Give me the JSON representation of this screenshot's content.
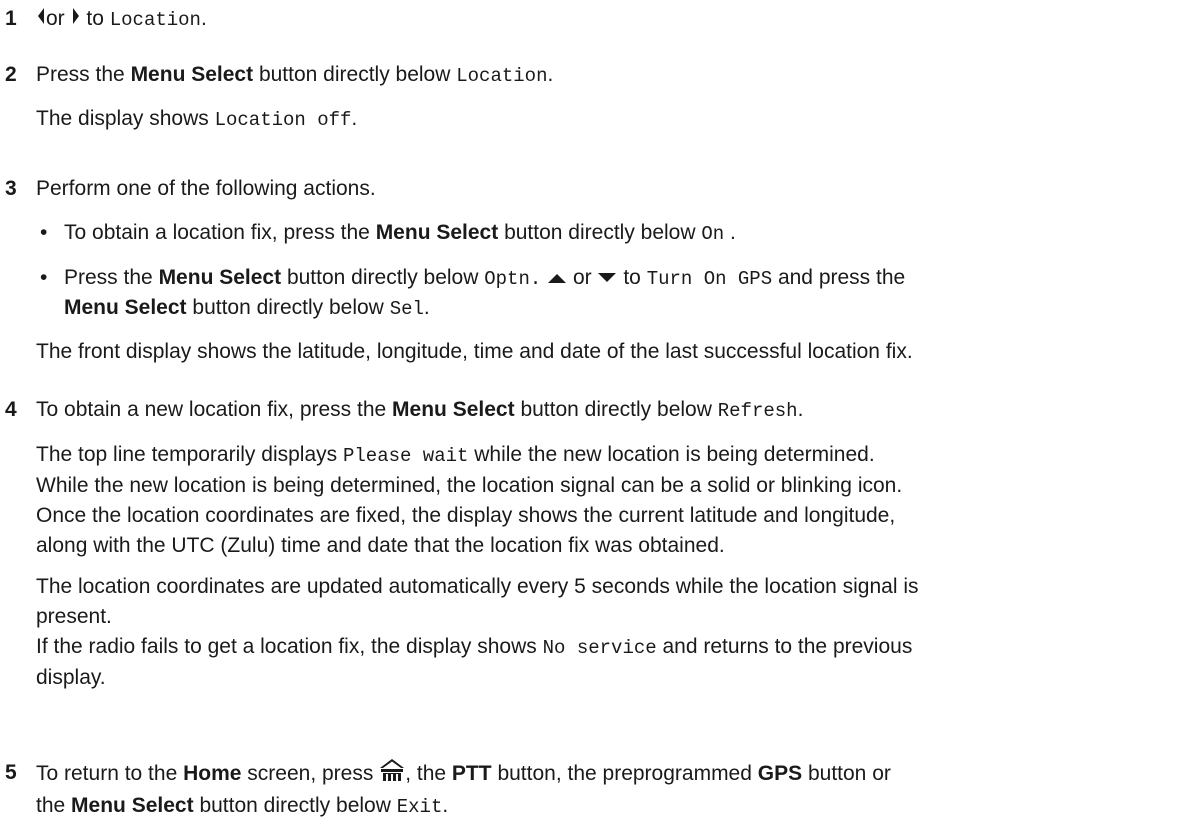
{
  "steps": [
    {
      "num": "1",
      "pre": "",
      "mid": "or",
      "post": "to",
      "target": "Location",
      "end": "."
    },
    {
      "num": "2",
      "a": "Press the",
      "btn": "Menu Select",
      "b": "button directly below",
      "target": "Location",
      "end": ".",
      "result_pre": "The display shows",
      "result_code": "Location off",
      "result_end": "."
    },
    {
      "num": "3",
      "intro": "Perform one of the following actions.",
      "bullet1": {
        "a": "To obtain a location fix, press the",
        "btn": "Menu Select",
        "b": "button directly below",
        "code": "On",
        "end": " ."
      },
      "bullet2": {
        "a": "Press the",
        "btn": "Menu Select",
        "b": "button directly below",
        "code1": "Optn.",
        "or": "or",
        "to": "to",
        "code2": "Turn On GPS",
        "c": "and press the",
        "btn2": "Menu Select",
        "d": "button directly below",
        "code3": "Sel",
        "end": "."
      },
      "result": "The front display shows the latitude, longitude, time and date of the last successful location fix."
    },
    {
      "num": "4",
      "a": "To obtain a new location fix, press the",
      "btn": "Menu Select",
      "b": "button directly below",
      "code": "Refresh",
      "end": ".",
      "p1_pre": "The top line temporarily displays",
      "p1_code": "Please wait",
      "p1_post": "while the new location is being determined.",
      "p1_line2": "While the new location is being determined, the location signal can be a solid or blinking icon.",
      "p1_line3": "Once the location coordinates are fixed, the display shows the current latitude and longitude,",
      "p1_line4": "along with the UTC (Zulu) time and date that the location fix was obtained.",
      "p2_line1": "The location coordinates are updated automatically every 5 seconds while the location signal is",
      "p2_line2": "present.",
      "p2_line3_pre": "If the radio fails to get a location fix, the display shows",
      "p2_line3_code": "No service",
      "p2_line3_post": "and returns to the previous",
      "p2_line4": "display."
    },
    {
      "num": "5",
      "a": "To return to the",
      "home": "Home",
      "b": "screen, press",
      "c": ", the",
      "ptt": "PTT",
      "d": "button, the preprogrammed",
      "gps": "GPS",
      "e": "button or",
      "f": "the",
      "btn": "Menu Select",
      "g": "button directly below",
      "code": "Exit",
      "end": "."
    }
  ],
  "icons": [
    "left-arrow-icon",
    "right-arrow-icon",
    "up-arrow-icon",
    "down-arrow-icon",
    "home-icon"
  ]
}
